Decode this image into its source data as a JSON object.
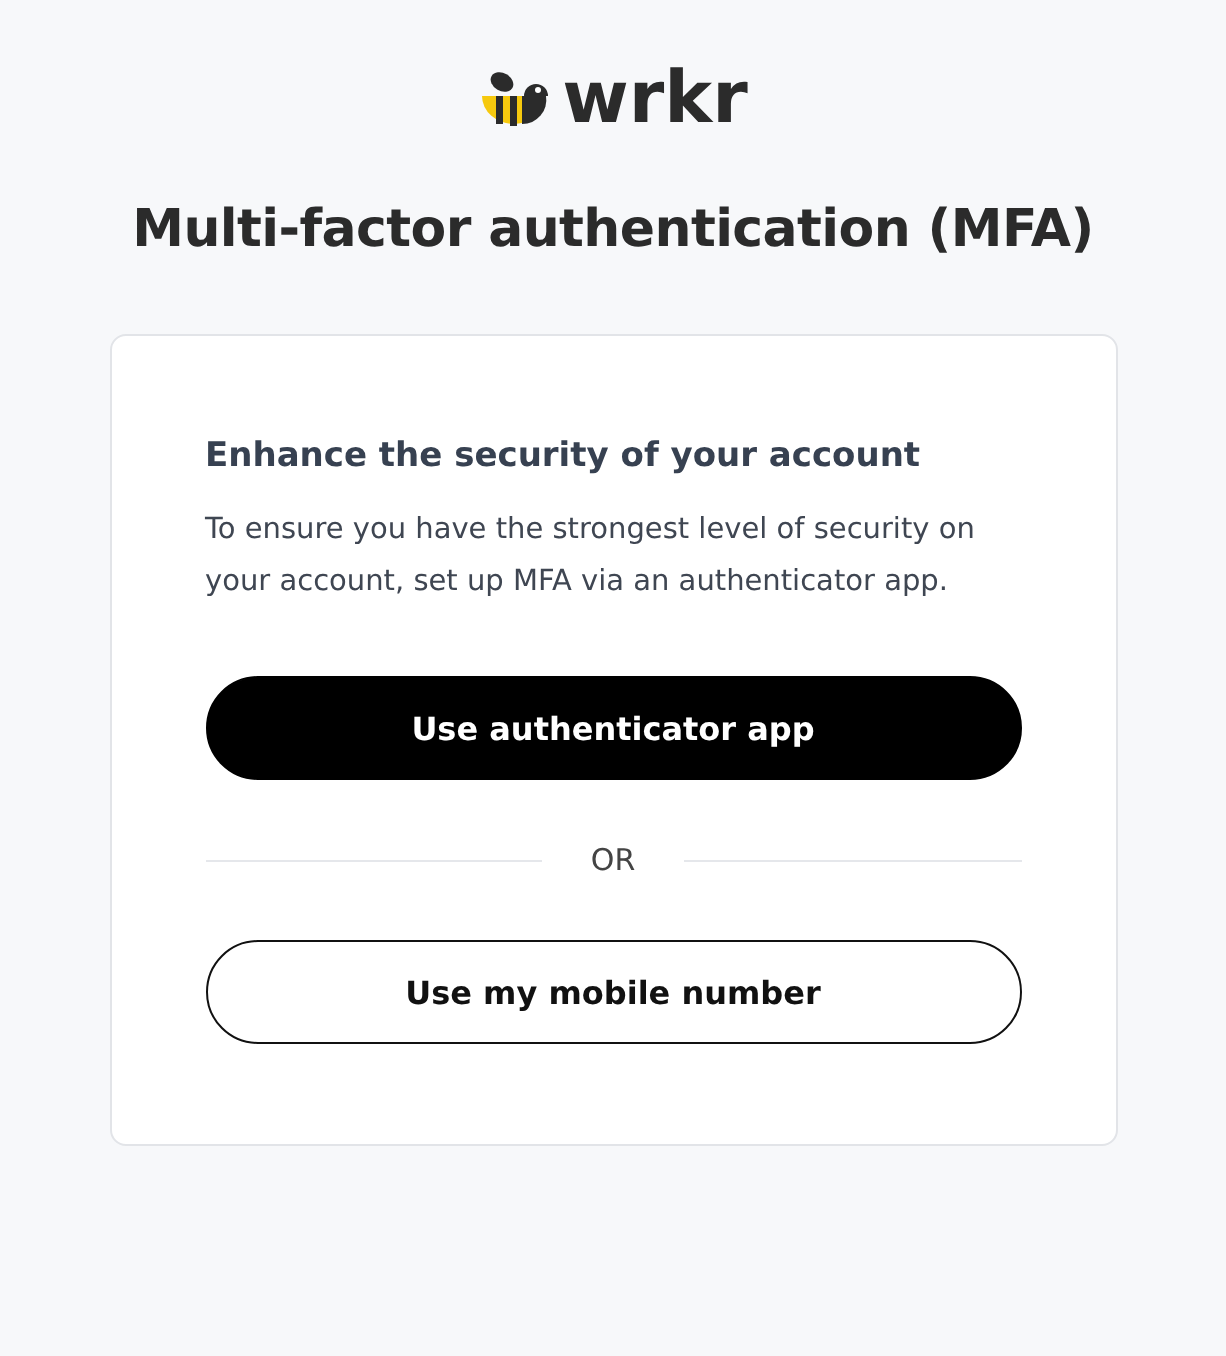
{
  "logo": {
    "text": "wrkr"
  },
  "title": "Multi-factor authentication (MFA)",
  "card": {
    "heading": "Enhance the security of your account",
    "description": "To ensure you have the strongest level of security on your account, set up MFA via an authenticator app.",
    "buttons": [
      {
        "label": "Use authenticator app",
        "kind": "primary"
      },
      {
        "label": "Use my mobile number",
        "kind": "secondary"
      }
    ],
    "divider_text": "OR"
  }
}
